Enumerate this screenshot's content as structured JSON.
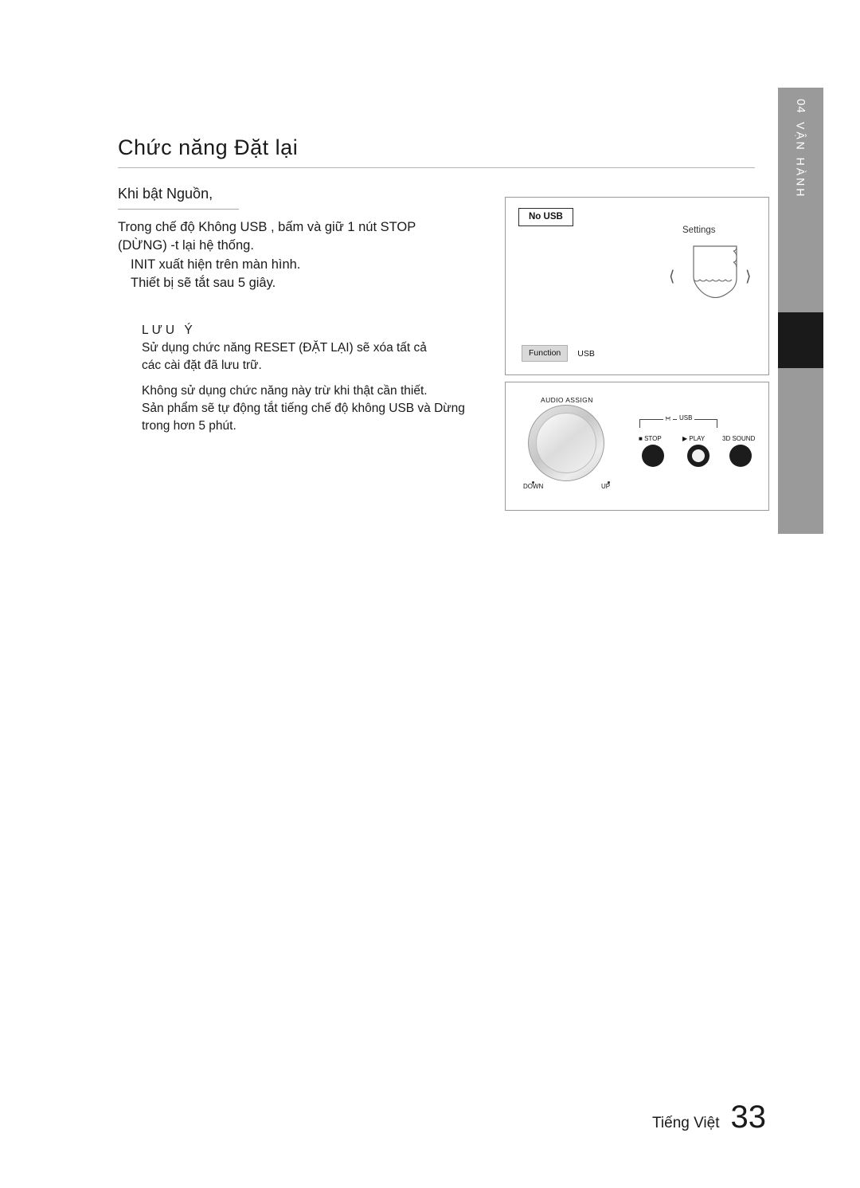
{
  "side_tab": {
    "number": "04",
    "label": "VẬN HÀNH"
  },
  "heading": "Chức năng Đặt lại",
  "subheading": "Khi bật Nguồn,",
  "body": {
    "line1": "Trong chế độ Không USB , bấm và giữ 1 nút STOP",
    "line2": "(DỪNG)  -t lại hệ thống.",
    "line3": "INIT xuất hiện trên màn hình.",
    "line4": "Thiết bị sẽ tắt sau 5 giây."
  },
  "note": {
    "title": "LƯU Ý",
    "line1": "Sử dụng chức năng RESET (ĐẶT LẠI) sẽ xóa tất cả",
    "line2": "các cài đặt đã lưu trữ.",
    "line3": "Không sử dụng chức năng này trừ khi thật cần thiết.",
    "line4": "Sản phẩm sẽ tự động tắt tiếng chế độ không USB và Dừng",
    "line5": "trong hơn 5 phút."
  },
  "figure_display": {
    "no_usb": "No USB",
    "settings": "Settings",
    "function_tag": "Function",
    "usb_label": "USB",
    "arrow_left": "chevron-left",
    "arrow_right": "chevron-right"
  },
  "figure_panel": {
    "audio_assign": "AUDIO ASSIGN",
    "down": "DOWN",
    "up": "UP",
    "usb": "USB",
    "stop": "STOP",
    "play": "PLAY",
    "sound_3d": "3D SOUND"
  },
  "footer": {
    "language": "Tiếng Việt",
    "page": "33"
  }
}
